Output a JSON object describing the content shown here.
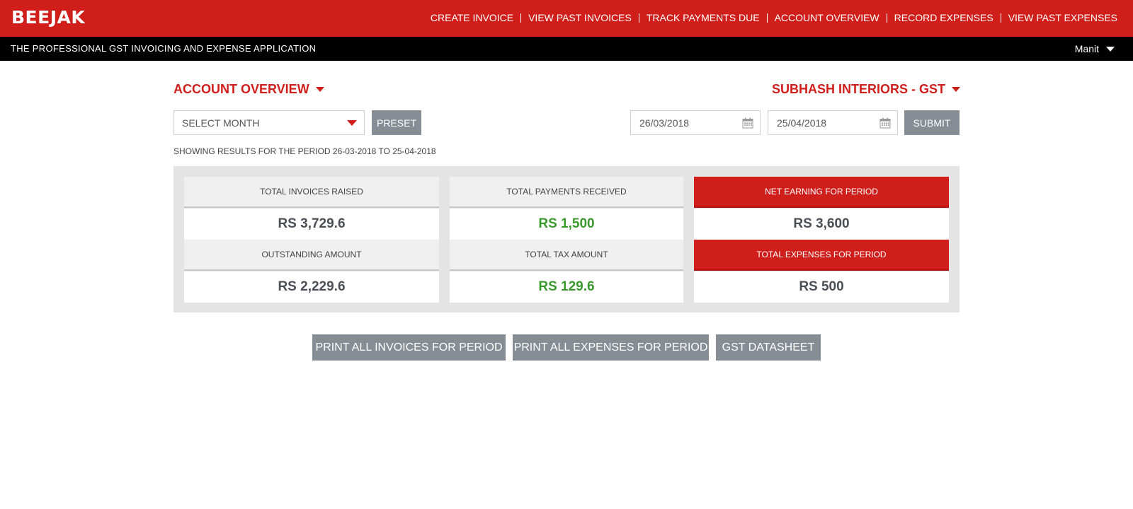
{
  "app": {
    "logo": "BEEJAK",
    "tagline": "THE PROFESSIONAL GST INVOICING AND EXPENSE APPLICATION",
    "user": "Manit"
  },
  "nav": [
    "CREATE INVOICE",
    "VIEW PAST INVOICES",
    "TRACK PAYMENTS DUE",
    "ACCOUNT OVERVIEW",
    "RECORD EXPENSES",
    "VIEW PAST EXPENSES"
  ],
  "page": {
    "title": "ACCOUNT OVERVIEW",
    "company": "SUBHASH INTERIORS - GST"
  },
  "filters": {
    "month_select": "SELECT MONTH",
    "preset_label": "PRESET",
    "date_from": "26/03/2018",
    "date_to": "25/04/2018",
    "submit_label": "SUBMIT",
    "period_note": "SHOWING RESULTS FOR THE PERIOD 26-03-2018 TO 25-04-2018"
  },
  "summary": {
    "total_invoices": {
      "label": "TOTAL INVOICES RAISED",
      "value": "RS 3,729.6"
    },
    "total_payments": {
      "label": "TOTAL PAYMENTS RECEIVED",
      "value": "RS 1,500"
    },
    "net_earning": {
      "label": "NET EARNING FOR PERIOD",
      "value": "RS 3,600"
    },
    "outstanding": {
      "label": "OUTSTANDING AMOUNT",
      "value": "RS 2,229.6"
    },
    "total_tax": {
      "label": "TOTAL TAX AMOUNT",
      "value": "RS 129.6"
    },
    "total_expenses": {
      "label": "TOTAL EXPENSES FOR PERIOD",
      "value": "RS 500"
    }
  },
  "actions": {
    "print_invoices": "PRINT ALL INVOICES FOR PERIOD",
    "print_expenses": "PRINT ALL EXPENSES FOR PERIOD",
    "gst_datasheet": "GST DATASHEET"
  },
  "colors": {
    "brand_red": "#d01e1a",
    "button_grey": "#868d95",
    "positive_green": "#3b9a2d"
  }
}
